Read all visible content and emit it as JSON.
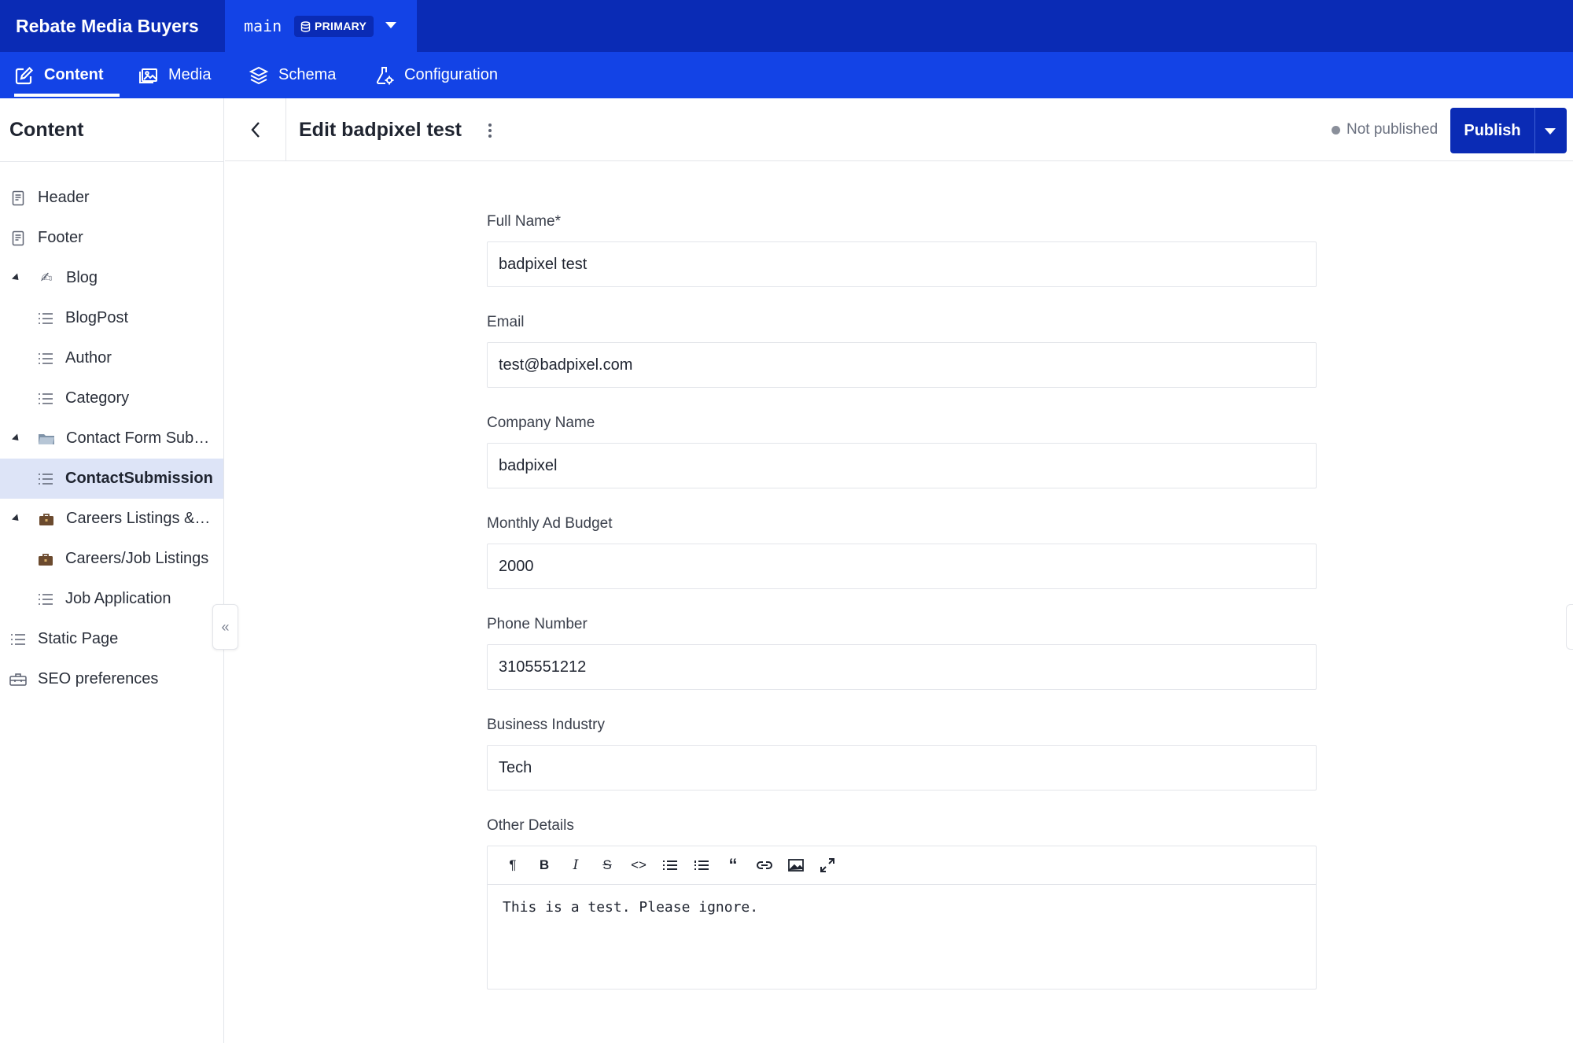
{
  "app": {
    "project_name": "Rebate Media Buyers",
    "environment": "main",
    "environment_badge": "PRIMARY",
    "accent_color": "#1343e6",
    "dark_accent_color": "#0a2bb5"
  },
  "nav": {
    "tabs": [
      {
        "label": "Content",
        "icon": "edit-icon",
        "active": true
      },
      {
        "label": "Media",
        "icon": "image-icon",
        "active": false
      },
      {
        "label": "Schema",
        "icon": "layers-icon",
        "active": false
      },
      {
        "label": "Configuration",
        "icon": "flask-gear-icon",
        "active": false
      }
    ]
  },
  "sidebar": {
    "title": "Content",
    "items": [
      {
        "label": "Header",
        "icon": "document-icon"
      },
      {
        "label": "Footer",
        "icon": "document-icon"
      },
      {
        "label": "Blog",
        "icon": "writing-hand-icon",
        "expanded": true
      },
      {
        "label": "BlogPost",
        "icon": "list-icon"
      },
      {
        "label": "Author",
        "icon": "list-icon"
      },
      {
        "label": "Category",
        "icon": "list-icon"
      },
      {
        "label": "Contact Form Sub…",
        "icon": "folder-icon",
        "expanded": true
      },
      {
        "label": "ContactSubmission",
        "icon": "list-icon",
        "selected": true
      },
      {
        "label": "Careers Listings &…",
        "icon": "briefcase-icon",
        "expanded": true
      },
      {
        "label": "Careers/Job Listings",
        "icon": "briefcase-icon"
      },
      {
        "label": "Job Application",
        "icon": "list-icon"
      },
      {
        "label": "Static Page",
        "icon": "list-icon"
      },
      {
        "label": "SEO preferences",
        "icon": "toolbox-icon"
      }
    ]
  },
  "editor": {
    "title": "Edit badpixel test",
    "status": "Not published",
    "publish_label": "Publish"
  },
  "form": {
    "full_name": {
      "label": "Full Name*",
      "value": "badpixel test"
    },
    "email": {
      "label": "Email",
      "value": "test@badpixel.com"
    },
    "company": {
      "label": "Company Name",
      "value": "badpixel"
    },
    "budget": {
      "label": "Monthly Ad Budget",
      "value": "2000"
    },
    "phone": {
      "label": "Phone Number",
      "value": "3105551212"
    },
    "industry": {
      "label": "Business Industry",
      "value": "Tech"
    },
    "details": {
      "label": "Other Details",
      "value": "This is a test. Please ignore.",
      "toolbar": [
        "paragraph-icon",
        "bold-icon",
        "italic-icon",
        "strikethrough-icon",
        "code-icon",
        "bullet-list-icon",
        "numbered-list-icon",
        "quote-icon",
        "link-icon",
        "image-icon",
        "fullscreen-icon"
      ]
    }
  }
}
